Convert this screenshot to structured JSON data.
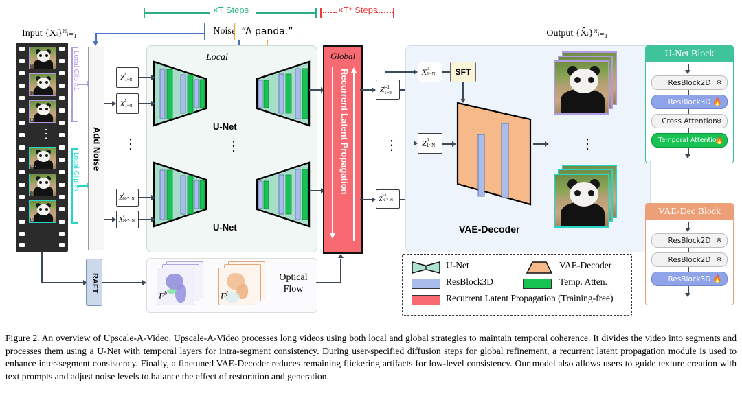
{
  "figure": {
    "number": "Figure 2.",
    "caption": "Figure 2.  An overview of Upscale-A-Video. Upscale-A-Video processes long videos using both local and global strategies to maintain temporal coherence. It divides the video into segments and processes them using a U-Net with temporal layers for intra-segment consistency. During user-specified diffusion steps for global refinement, a recurrent latent propagation module is used to enhance inter-segment consistency. Finally, a finetuned VAE-Decoder reduces remaining flickering artifacts for low-level consistency. Our model also allows users to guide texture creation with text prompts and adjust noise levels to balance the effect of restoration and generation."
  },
  "steps": {
    "local_steps_label": "×T Steps",
    "global_steps_label": "×T* Steps",
    "local_color": "#2eb086",
    "global_color": "#ec3b3b"
  },
  "input": {
    "title": "Input {Xᵢ}ᴺᵢ₌₁",
    "clip_first_label": "Local Clip #1",
    "clip_last_label": "Local Clip #k",
    "clip_first_color": "#b09ae0",
    "clip_last_color": "#26d6c8",
    "frame_labels_first": [
      "1",
      "⋮",
      "8"
    ],
    "frame_labels_last": [
      "N-7",
      "⋮",
      "N"
    ]
  },
  "controls": {
    "noise_level": "Noise Level τ",
    "noise_color": "#4a72c4",
    "prompt": "“A panda.”",
    "prompt_color": "#f0a830",
    "add_noise": "Add Noise"
  },
  "local": {
    "section_label": "Local",
    "unet_label": "U-Net",
    "latents_top": [
      "Zₜ₁₋₈",
      "Xˢ₁₋₈"
    ],
    "latents_bottom": [
      "Zₜ",
      "Xˢ"
    ],
    "latent_top_z_base": "Z",
    "latent_top_z_sup": "t",
    "latent_top_z_sub": "1~8",
    "latent_top_x_base": "X",
    "latent_top_x_sup": "s",
    "latent_top_x_sub": "1~8",
    "latent_bot_z_base": "Z",
    "latent_bot_z_sup": "t",
    "latent_bot_z_sub": "N-7~N",
    "latent_bot_x_base": "X",
    "latent_bot_x_sup": "s",
    "latent_bot_x_sub": "N-7~N",
    "ellipsis": "⋮"
  },
  "global": {
    "section_label": "Global",
    "module_label": "Recurrent Latent Propagation",
    "color": "#f86a72"
  },
  "flow": {
    "raft": "RAFT",
    "label": "Optical Flow",
    "backward": "Fᵇ",
    "forward": "Fᶠ",
    "backward_base": "F",
    "backward_sup": "b",
    "forward_base": "F",
    "forward_sup": "f"
  },
  "decoder": {
    "panel_label": "VAE-Decoder",
    "sft": "SFT",
    "x_base": "X",
    "x_sup": "0",
    "x_sub": "1~N",
    "z_base": "Z",
    "z_sup": "0",
    "z_sub": "1~N",
    "zin_top_base": "Z",
    "zin_top_sup": "t-1",
    "zin_top_sub": "1~8",
    "zin_bot_base": "Z",
    "zin_bot_sup": "t-1",
    "zin_bot_sub": "N-7~N",
    "output_title": "Output {X̂ᵢ}ᴺᵢ₌₁"
  },
  "legend": {
    "items": [
      {
        "label": "U-Net",
        "shape": "unet-bowtie",
        "color": "#aee3cf"
      },
      {
        "label": "VAE-Decoder",
        "shape": "trapezoid",
        "color": "#f5b98a"
      },
      {
        "label": "ResBlock3D",
        "shape": "rect",
        "color": "#a9bdec"
      },
      {
        "label": "Temp. Atten.",
        "shape": "rect",
        "color": "#17c352"
      },
      {
        "label": "Recurrent Latent Propagation (Training-free)",
        "shape": "rect",
        "color": "#f86a72"
      }
    ]
  },
  "blocks": [
    {
      "title": "U-Net Block",
      "header_color": "#3ec39a",
      "rows": [
        {
          "label": "ResBlock2D",
          "fill": "#f2f2f2",
          "text": "#222",
          "icon": "snowflake-icon",
          "glyph": "❄"
        },
        {
          "label": "ResBlock3D",
          "fill": "#8fa3e8",
          "text": "#fff",
          "icon": "fire-icon",
          "glyph": "🔥"
        },
        {
          "label": "Cross Attention",
          "fill": "#f2f2f2",
          "text": "#222",
          "icon": "snowflake-icon",
          "glyph": "❄"
        },
        {
          "label": "Temporal Attention",
          "fill": "#17c352",
          "text": "#fff",
          "icon": "fire-icon",
          "glyph": "🔥"
        }
      ]
    },
    {
      "title": "VAE-Dec Block",
      "header_color": "#eda077",
      "rows": [
        {
          "label": "ResBlock2D",
          "fill": "#f2f2f2",
          "text": "#222",
          "icon": "snowflake-icon",
          "glyph": "❄"
        },
        {
          "label": "ResBlock2D",
          "fill": "#f2f2f2",
          "text": "#222",
          "icon": "snowflake-icon",
          "glyph": "❄"
        },
        {
          "label": "ResBlock3D",
          "fill": "#8fa3e8",
          "text": "#fff",
          "icon": "fire-icon",
          "glyph": "🔥"
        }
      ]
    }
  ]
}
